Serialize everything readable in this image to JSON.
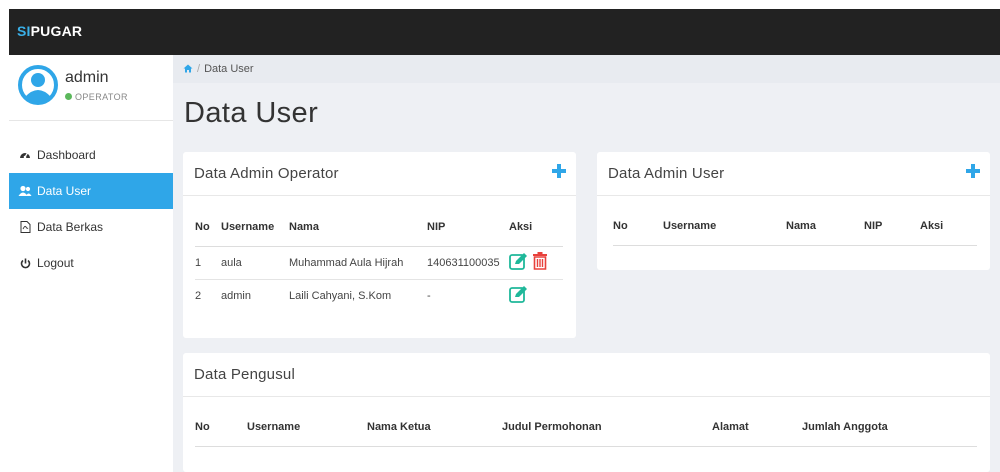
{
  "app": {
    "brand_prefix": "SI",
    "brand_rest": "PUGAR"
  },
  "profile": {
    "username": "admin",
    "role": "OPERATOR"
  },
  "sidebar": {
    "items": [
      {
        "label": "Dashboard",
        "icon": "dashboard-icon"
      },
      {
        "label": "Data User",
        "icon": "users-icon",
        "active": true
      },
      {
        "label": "Data Berkas",
        "icon": "file-pdf-icon"
      },
      {
        "label": "Logout",
        "icon": "power-icon"
      }
    ]
  },
  "breadcrumb": {
    "home_icon": "home-icon",
    "current": "Data User"
  },
  "page": {
    "title": "Data User"
  },
  "panel_operator": {
    "title": "Data Admin Operator",
    "columns": [
      "No",
      "Username",
      "Nama",
      "NIP",
      "Aksi"
    ],
    "rows": [
      {
        "no": "1",
        "username": "aula",
        "nama": "Muhammad Aula Hijrah",
        "nip": "140631100035"
      },
      {
        "no": "2",
        "username": "admin",
        "nama": "Laili Cahyani, S.Kom",
        "nip": "-"
      }
    ]
  },
  "panel_user": {
    "title": "Data Admin User",
    "columns": [
      "No",
      "Username",
      "Nama",
      "NIP",
      "Aksi"
    ]
  },
  "panel_pengusul": {
    "title": "Data Pengusul",
    "columns": [
      "No",
      "Username",
      "Nama Ketua",
      "Judul Permohonan",
      "Alamat",
      "Jumlah Anggota"
    ]
  },
  "colors": {
    "accent": "#2fa6e8",
    "edit": "#1fb89a",
    "delete": "#e8413c",
    "topbar": "#222222"
  }
}
